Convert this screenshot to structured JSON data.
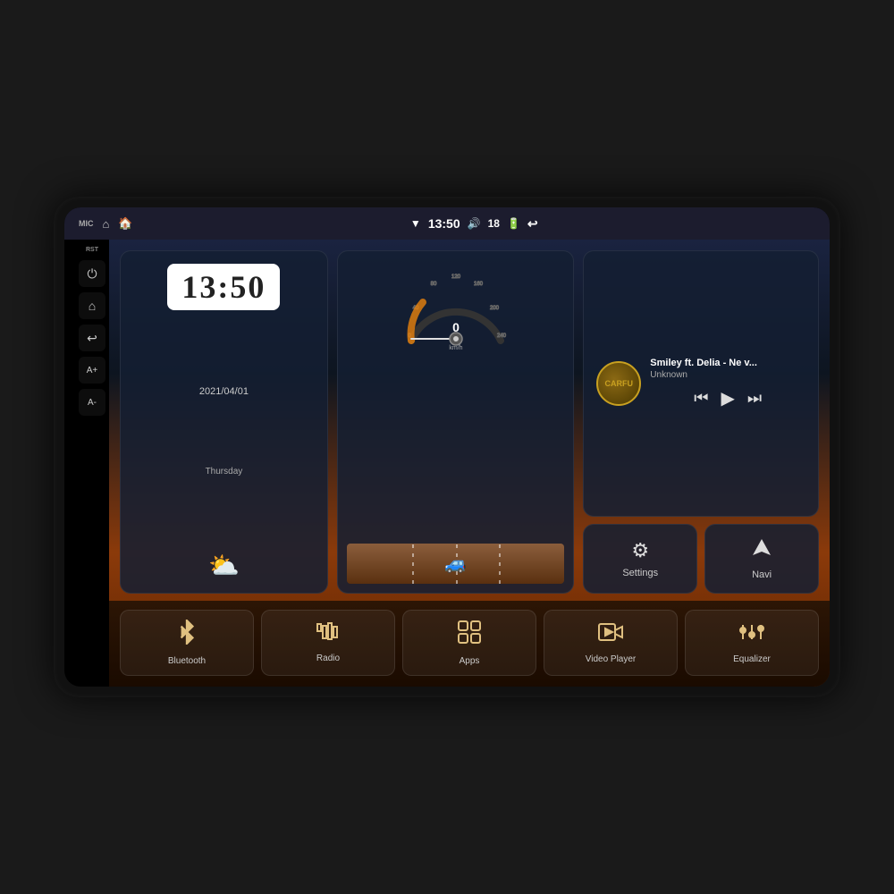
{
  "device": {
    "outer_bg": "#111",
    "screen_bg": "#000"
  },
  "status_bar": {
    "mic_label": "MIC",
    "rst_label": "RST",
    "time": "13:50",
    "wifi_icon": "📶",
    "volume_label": "18",
    "icons": [
      "🏠",
      "⊟",
      "↩"
    ]
  },
  "side_panel": {
    "rst_label": "RST",
    "buttons": [
      "⏻",
      "🏠",
      "↩",
      "A+",
      "A-"
    ]
  },
  "clock_widget": {
    "time": "13:50",
    "date": "2021/04/01",
    "day": "Thursday",
    "weather_emoji": "⛅"
  },
  "speedometer": {
    "speed_value": "0",
    "unit": "km/h",
    "min": 0,
    "max": 240,
    "current": 0
  },
  "music": {
    "title": "Smiley ft. Delia - Ne v...",
    "artist": "Unknown",
    "album_label": "CARFU",
    "prev_icon": "⏮",
    "play_icon": "▶",
    "next_icon": "⏭"
  },
  "quick_actions": {
    "settings": {
      "label": "Settings",
      "icon": "⚙"
    },
    "navi": {
      "label": "Navi",
      "icon": "◮"
    }
  },
  "dock": [
    {
      "id": "bluetooth",
      "label": "Bluetooth",
      "icon": "bluetooth"
    },
    {
      "id": "radio",
      "label": "Radio",
      "icon": "radio"
    },
    {
      "id": "apps",
      "label": "Apps",
      "icon": "apps"
    },
    {
      "id": "video-player",
      "label": "Video Player",
      "icon": "video"
    },
    {
      "id": "equalizer",
      "label": "Equalizer",
      "icon": "equalizer"
    }
  ]
}
